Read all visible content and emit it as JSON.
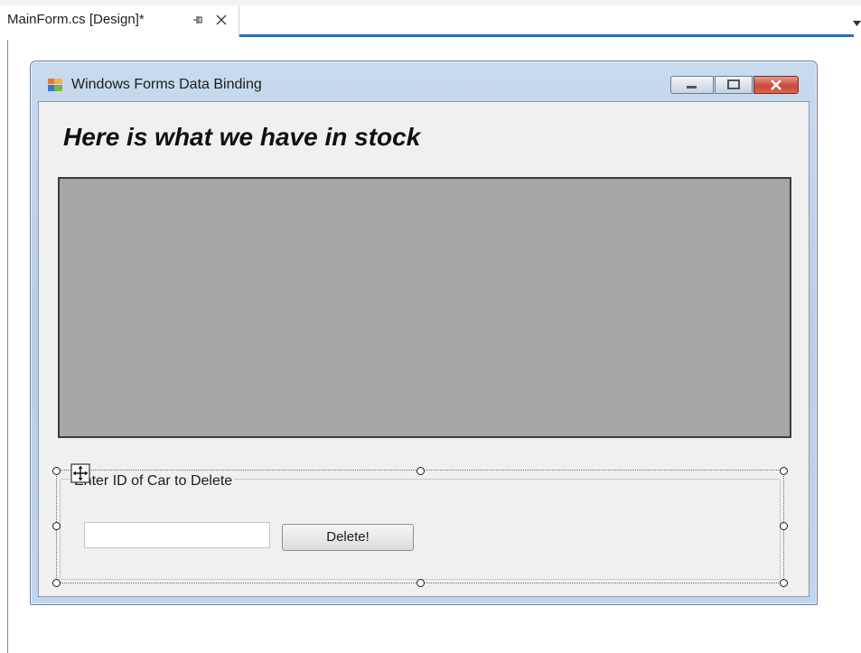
{
  "ide": {
    "tab_label": "MainForm.cs [Design]*",
    "pin_icon": "pin-icon",
    "close_icon": "close-icon",
    "dropdown_icon": "chevron-down-icon",
    "accent_color": "#2c6cb3"
  },
  "form": {
    "title": "Windows Forms Data Binding",
    "app_icon": "windows-form-icon",
    "caption_buttons": [
      "minimize",
      "maximize",
      "close"
    ],
    "heading": "Here is what we have in stock",
    "grid_background": "#a6a6a6",
    "group_box": {
      "caption": "Enter ID of Car to Delete",
      "input_value": "",
      "button_label": "Delete!",
      "selected_in_designer": true
    }
  }
}
